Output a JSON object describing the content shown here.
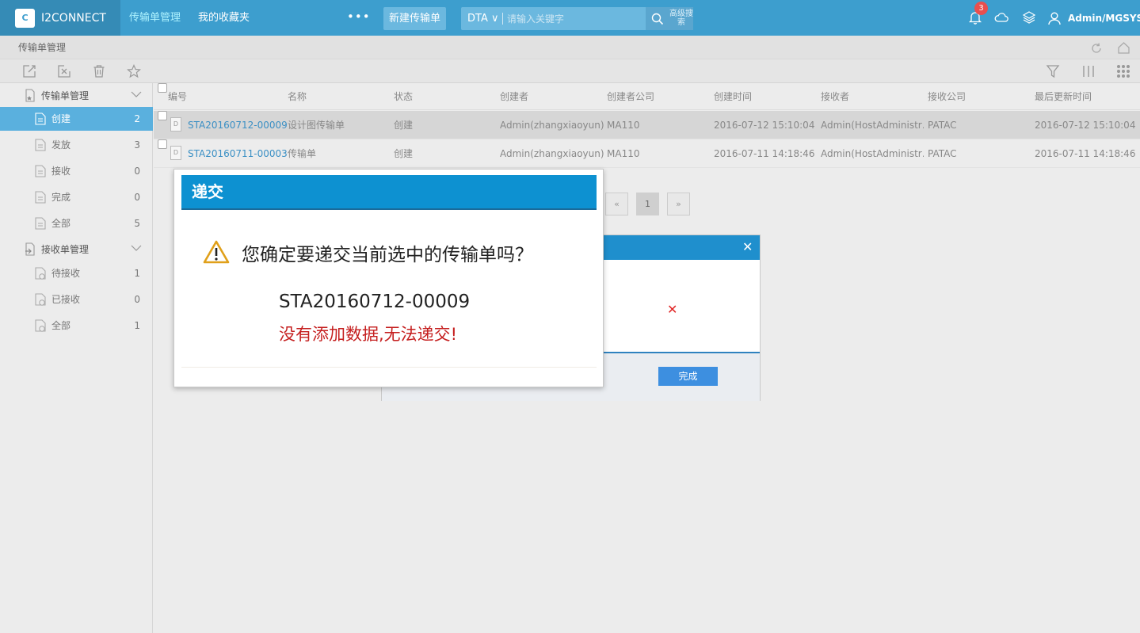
{
  "app": {
    "name": "I2CONNECT",
    "logo_glyph": "C"
  },
  "nav": {
    "tabs": [
      {
        "label": "传输单管理"
      },
      {
        "label": "我的收藏夹"
      }
    ],
    "more": "•••",
    "new_button": "新建传输单"
  },
  "search": {
    "scope": "DTA",
    "placeholder": "请输入关键字",
    "advanced": "高级搜索"
  },
  "notifications": {
    "count": "3"
  },
  "user": {
    "name": "Admin/MGSYS"
  },
  "breadcrumb": "传输单管理",
  "sidebar": {
    "groups": [
      {
        "label": "传输单管理",
        "items": [
          {
            "label": "创建",
            "count": "2"
          },
          {
            "label": "发放",
            "count": "3"
          },
          {
            "label": "接收",
            "count": "0"
          },
          {
            "label": "完成",
            "count": "0"
          },
          {
            "label": "全部",
            "count": "5"
          }
        ]
      },
      {
        "label": "接收单管理",
        "items": [
          {
            "label": "待接收",
            "count": "1"
          },
          {
            "label": "已接收",
            "count": "0"
          },
          {
            "label": "全部",
            "count": "1"
          }
        ]
      }
    ]
  },
  "table": {
    "columns": [
      "编号",
      "名称",
      "状态",
      "创建者",
      "创建者公司",
      "创建时间",
      "接收者",
      "接收公司",
      "最后更新时间"
    ],
    "rows": [
      {
        "id": "STA20160712-00009",
        "name": "设计图传输单",
        "status": "创建",
        "creator": "Admin(zhangxiaoyun)",
        "creator_company": "MA110",
        "created": "2016-07-12 15:10:04",
        "receiver": "Admin(HostAdministr…",
        "receiver_company": "PATAC",
        "updated": "2016-07-12 15:10:04",
        "doc": "D",
        "checked": true
      },
      {
        "id": "STA20160711-00003",
        "name": "传输单",
        "status": "创建",
        "creator": "Admin(zhangxiaoyun)",
        "creator_company": "MA110",
        "created": "2016-07-11 14:18:46",
        "receiver": "Admin(HostAdministr…",
        "receiver_company": "PATAC",
        "updated": "2016-07-11 14:18:46",
        "doc": "D",
        "checked": false
      }
    ]
  },
  "pagination": {
    "prev": "«",
    "current": "1",
    "next": "»"
  },
  "result_dialog": {
    "close": "✕",
    "error_mark": "✕",
    "done_button": "完成"
  },
  "confirm_dialog": {
    "title": "递交",
    "question": "您确定要递交当前选中的传输单吗？",
    "code": "STA20160712-00009",
    "error": "没有添加数据,无法递交!"
  },
  "colors": {
    "topbar": "#3d9ece",
    "active_item": "#5ab0de",
    "dialog_header": "#0d91d1",
    "error": "#c51f1f"
  }
}
